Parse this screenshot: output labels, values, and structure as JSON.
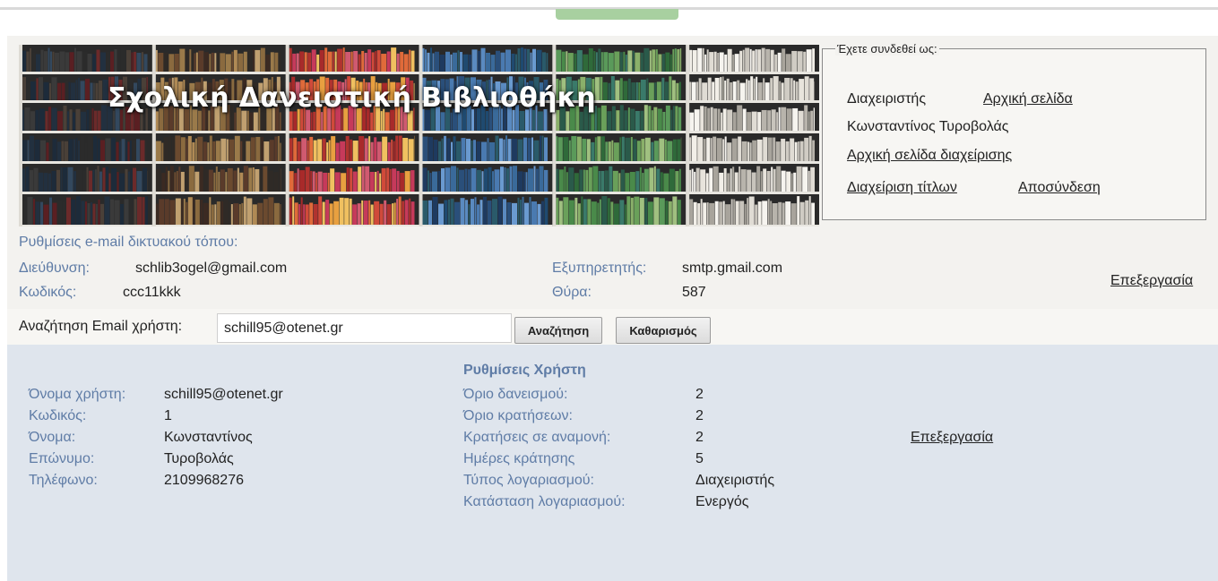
{
  "banner": {
    "title": "Σχολική Δανειστική Βιβλιοθήκη"
  },
  "login_box": {
    "legend": "Έχετε συνδεθεί ως:",
    "role": "Διαχειριστής",
    "home_link": "Αρχική σελίδα",
    "user_name": "Κωνσταντίνος Τυροβολάς",
    "admin_home_link": "Αρχική σελίδα διαχείρισης",
    "titles_link": "Διαχείριση τίτλων",
    "logout_link": "Αποσύνδεση"
  },
  "email_settings": {
    "heading": "Ρυθμίσεις e-mail δικτυακού τόπου:",
    "address_label": "Διεύθυνση:",
    "address_value": "schlib3ogel@gmail.com",
    "password_label": "Κωδικός:",
    "password_value": "ccc11kkk",
    "server_label": "Εξυπηρετητής:",
    "server_value": "smtp.gmail.com",
    "port_label": "Θύρα:",
    "port_value": "587",
    "edit_link": "Επεξεργασία"
  },
  "search": {
    "label": "Αναζήτηση Email χρήστη:",
    "value": "schill95@otenet.gr",
    "search_button": "Αναζήτηση",
    "clear_button": "Καθαρισμός"
  },
  "user": {
    "username_label": "Όνομα χρήστη:",
    "username_value": "schill95@otenet.gr",
    "password_label": "Κωδικός:",
    "password_value": "1",
    "firstname_label": "Όνομα:",
    "firstname_value": "Κωνσταντίνος",
    "lastname_label": "Επώνυμο:",
    "lastname_value": "Τυροβολάς",
    "phone_label": "Τηλέφωνο:",
    "phone_value": "2109968276"
  },
  "user_settings": {
    "heading": "Ρυθμίσεις Χρήστη",
    "loan_limit_label": "Όριο δανεισμού:",
    "loan_limit_value": "2",
    "reservation_limit_label": "Όριο κρατήσεων:",
    "reservation_limit_value": "2",
    "pending_label": "Κρατήσεις σε αναμονή:",
    "pending_value": "2",
    "hold_days_label": "Ημέρες κράτησης",
    "hold_days_value": "5",
    "account_type_label": "Τύπος λογαριασμού:",
    "account_type_value": "Διαχειριστής",
    "account_status_label": "Κατάσταση λογαριασμού:",
    "account_status_value": "Ενεργός",
    "edit_link": "Επεξεργασία"
  },
  "colors": {
    "label_blue": "#5f7ca6",
    "link_blue": "#4a68a8",
    "panel_bg": "#dfe5ed",
    "page_bg": "#f3f2ef"
  }
}
